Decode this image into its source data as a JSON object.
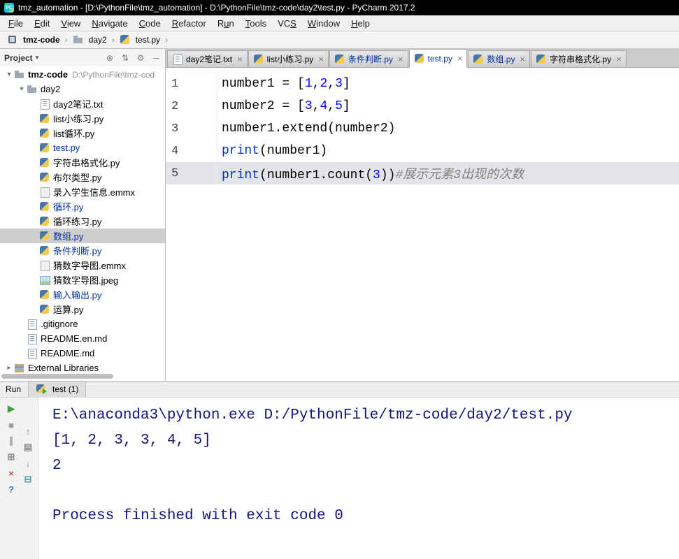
{
  "title_bar": {
    "logo_text": "PC",
    "title": "tmz_automation - [D:\\PythonFile\\tmz_automation] - D:\\PythonFile\\tmz-code\\day2\\test.py - PyCharm 2017.2"
  },
  "menu_bar": {
    "items": [
      {
        "label": "File",
        "mnemonic": 0
      },
      {
        "label": "Edit",
        "mnemonic": 0
      },
      {
        "label": "View",
        "mnemonic": 0
      },
      {
        "label": "Navigate",
        "mnemonic": 0
      },
      {
        "label": "Code",
        "mnemonic": 0
      },
      {
        "label": "Refactor",
        "mnemonic": 0
      },
      {
        "label": "Run",
        "mnemonic": 1
      },
      {
        "label": "Tools",
        "mnemonic": 0
      },
      {
        "label": "VCS",
        "mnemonic": 2
      },
      {
        "label": "Window",
        "mnemonic": 0
      },
      {
        "label": "Help",
        "mnemonic": 0
      }
    ]
  },
  "breadcrumbs": {
    "items": [
      {
        "label": "tmz-code",
        "icon": "module"
      },
      {
        "label": "day2",
        "icon": "folder"
      },
      {
        "label": "test.py",
        "icon": "python"
      }
    ]
  },
  "project_panel": {
    "title": "Project",
    "header_icons": [
      {
        "name": "locate-icon",
        "glyph": "⊕"
      },
      {
        "name": "collapse-all-icon",
        "glyph": "⇅"
      },
      {
        "name": "settings-gear-icon",
        "glyph": "⚙"
      },
      {
        "name": "hide-panel-icon",
        "glyph": "─"
      }
    ],
    "tree": [
      {
        "label": "tmz-code",
        "hint": "D:\\PythonFile\\tmz-cod",
        "indent": 0,
        "chevron": "down",
        "icon": "folder",
        "bold": true
      },
      {
        "label": "day2",
        "indent": 1,
        "chevron": "down",
        "icon": "folder"
      },
      {
        "label": "day2笔记.txt",
        "indent": 2,
        "icon": "text"
      },
      {
        "label": "list小练习.py",
        "indent": 2,
        "icon": "python"
      },
      {
        "label": "list循环.py",
        "indent": 2,
        "icon": "python"
      },
      {
        "label": "test.py",
        "indent": 2,
        "icon": "python",
        "color": "modified"
      },
      {
        "label": "字符串格式化.py",
        "indent": 2,
        "icon": "python"
      },
      {
        "label": "布尔类型.py",
        "indent": 2,
        "icon": "python"
      },
      {
        "label": "录入学生信息.emmx",
        "indent": 2,
        "icon": "file"
      },
      {
        "label": "循环.py",
        "indent": 2,
        "icon": "python",
        "color": "modified"
      },
      {
        "label": "循环练习.py",
        "indent": 2,
        "icon": "python"
      },
      {
        "label": "数组.py",
        "indent": 2,
        "icon": "python",
        "color": "modified",
        "selected": true
      },
      {
        "label": "条件判断.py",
        "indent": 2,
        "icon": "python",
        "color": "modified"
      },
      {
        "label": "猜数字导图.emmx",
        "indent": 2,
        "icon": "file"
      },
      {
        "label": "猜数字导图.jpeg",
        "indent": 2,
        "icon": "image"
      },
      {
        "label": "输入输出.py",
        "indent": 2,
        "icon": "python",
        "color": "modified"
      },
      {
        "label": "运算.py",
        "indent": 2,
        "icon": "python"
      },
      {
        "label": ".gitignore",
        "indent": 1,
        "icon": "text"
      },
      {
        "label": "README.en.md",
        "indent": 1,
        "icon": "text"
      },
      {
        "label": "README.md",
        "indent": 1,
        "icon": "text"
      },
      {
        "label": "External Libraries",
        "indent": 0,
        "chevron": "right",
        "icon": "library"
      }
    ]
  },
  "editor": {
    "tabs": [
      {
        "label": "day2笔记.txt",
        "icon": "text",
        "active": false,
        "modified": false
      },
      {
        "label": "list小练习.py",
        "icon": "python",
        "active": false,
        "modified": false
      },
      {
        "label": "条件判断.py",
        "icon": "python",
        "active": false,
        "modified": true
      },
      {
        "label": "test.py",
        "icon": "python",
        "active": true,
        "modified": true
      },
      {
        "label": "数组.py",
        "icon": "python",
        "active": false,
        "modified": true
      },
      {
        "label": "字符串格式化.py",
        "icon": "python",
        "active": false,
        "modified": false
      }
    ],
    "lines": [
      {
        "num": "1",
        "current": false,
        "segments": [
          {
            "text": "number1 = [",
            "cls": "plain"
          },
          {
            "text": "1",
            "cls": "num"
          },
          {
            "text": ",",
            "cls": "plain"
          },
          {
            "text": "2",
            "cls": "num"
          },
          {
            "text": ",",
            "cls": "plain"
          },
          {
            "text": "3",
            "cls": "num"
          },
          {
            "text": "]",
            "cls": "plain"
          }
        ]
      },
      {
        "num": "2",
        "current": false,
        "segments": [
          {
            "text": "number2 = [",
            "cls": "plain"
          },
          {
            "text": "3",
            "cls": "num"
          },
          {
            "text": ",",
            "cls": "plain"
          },
          {
            "text": "4",
            "cls": "num"
          },
          {
            "text": ",",
            "cls": "plain"
          },
          {
            "text": "5",
            "cls": "num"
          },
          {
            "text": "]",
            "cls": "plain"
          }
        ]
      },
      {
        "num": "3",
        "current": false,
        "segments": [
          {
            "text": "number1.extend(number2)",
            "cls": "plain"
          }
        ]
      },
      {
        "num": "4",
        "current": false,
        "segments": [
          {
            "text": "print",
            "cls": "builtin"
          },
          {
            "text": "(number1)",
            "cls": "plain"
          }
        ]
      },
      {
        "num": "5",
        "current": true,
        "segments": [
          {
            "text": "print",
            "cls": "builtin"
          },
          {
            "text": "(number1.count(",
            "cls": "plain"
          },
          {
            "text": "3",
            "cls": "num"
          },
          {
            "text": "))",
            "cls": "plain"
          },
          {
            "text": "#展示元素3出现的次数",
            "cls": "comment"
          }
        ]
      }
    ]
  },
  "run_panel": {
    "label": "Run",
    "tab_label": "test (1)",
    "toolbar_col1": [
      {
        "name": "rerun-icon",
        "glyph": "▶",
        "color": "#3fa142"
      },
      {
        "name": "stop-icon",
        "glyph": "■",
        "color": "#9aa0a6"
      },
      {
        "name": "pause-output-icon",
        "glyph": "∥",
        "color": "#9aa0a6"
      },
      {
        "name": "show-console-icon",
        "glyph": "⊞",
        "color": "#8a8a8a"
      },
      {
        "name": "close-icon",
        "glyph": "×",
        "color": "#c75450"
      },
      {
        "name": "help-icon",
        "glyph": "?",
        "color": "#3b7fc4"
      }
    ],
    "toolbar_col2": [
      {
        "name": "restore-layout-icon",
        "glyph": "↑",
        "color": "#8a8a8a"
      },
      {
        "name": "print-icon",
        "glyph": "▤",
        "color": "#8a8a8a"
      },
      {
        "name": "scroll-to-end-icon",
        "glyph": "↓",
        "color": "#8a8a8a"
      },
      {
        "name": "clear-all-icon",
        "glyph": "⊟",
        "color": "#4aa0a0"
      }
    ],
    "console_lines": [
      "E:\\anaconda3\\python.exe D:/PythonFile/tmz-code/day2/test.py",
      "[1, 2, 3, 3, 4, 5]",
      "2",
      "",
      "Process finished with exit code 0"
    ]
  },
  "colors": {
    "modified_file_blue": "#0032a0",
    "number_literal": "#0000ff",
    "builtin_blue": "#0033b3",
    "comment_gray": "#808080",
    "console_text": "#14147a",
    "caret_line_bg": "#e2e4e7",
    "inactive_selection_bg": "#cecece"
  }
}
